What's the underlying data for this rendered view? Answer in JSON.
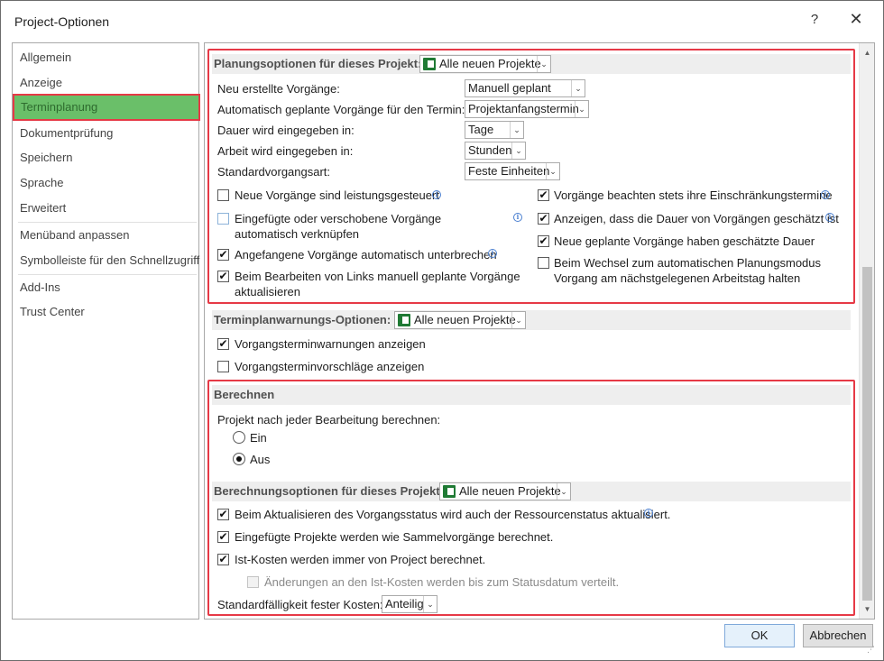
{
  "window": {
    "title": "Project-Optionen",
    "help_glyph": "?",
    "close_glyph": "✕"
  },
  "sidebar": {
    "items": [
      {
        "label": "Allgemein"
      },
      {
        "label": "Anzeige"
      },
      {
        "label": "Terminplanung"
      },
      {
        "label": "Dokumentprüfung"
      },
      {
        "label": "Speichern"
      },
      {
        "label": "Sprache"
      },
      {
        "label": "Erweitert"
      },
      {
        "label": "Menüband anpassen"
      },
      {
        "label": "Symbolleiste für den Schnellzugriff"
      },
      {
        "label": "Add-Ins"
      },
      {
        "label": "Trust Center"
      }
    ],
    "selected": "Terminplanung"
  },
  "planung": {
    "header": "Planungsoptionen für dieses Projekt:",
    "project_select": "Alle neuen Projekte",
    "rows": [
      {
        "label": "Neu erstellte Vorgänge:",
        "value": "Manuell geplant"
      },
      {
        "label": "Automatisch geplante Vorgänge für den Termin:",
        "value": "Projektanfangstermin"
      },
      {
        "label": "Dauer wird eingegeben in:",
        "value": "Tage"
      },
      {
        "label": "Arbeit wird eingegeben in:",
        "value": "Stunden"
      },
      {
        "label": "Standardvorgangsart:",
        "value": "Feste Einheiten"
      }
    ],
    "left_checks": [
      {
        "label": "Neue Vorgänge sind leistungsgesteuert",
        "checked": false
      },
      {
        "label": "Eingefügte oder verschobene Vorgänge automatisch verknüpfen",
        "checked": false
      },
      {
        "label": "Angefangene Vorgänge automatisch unterbrechen",
        "checked": true
      },
      {
        "label": "Beim Bearbeiten von Links manuell geplante Vorgänge aktualisieren",
        "checked": true
      }
    ],
    "right_checks": [
      {
        "label": "Vorgänge beachten stets ihre Einschränkungstermine",
        "checked": true
      },
      {
        "label": "Anzeigen, dass die Dauer von Vorgängen geschätzt ist",
        "checked": true
      },
      {
        "label": "Neue geplante Vorgänge haben geschätzte Dauer",
        "checked": true
      },
      {
        "label": "Beim Wechsel zum automatischen Planungsmodus Vorgang am nächstgelegenen Arbeitstag halten",
        "checked": false
      }
    ]
  },
  "warnungen": {
    "header": "Terminplanwarnungs-Optionen:",
    "project_select": "Alle neuen Projekte",
    "checks": [
      {
        "label": "Vorgangsterminwarnungen anzeigen",
        "checked": true
      },
      {
        "label": "Vorgangsterminvorschläge anzeigen",
        "checked": false
      }
    ]
  },
  "berechnen": {
    "header": "Berechnen",
    "question": "Projekt nach jeder Bearbeitung berechnen:",
    "radios": [
      {
        "label": "Ein",
        "selected": false
      },
      {
        "label": "Aus",
        "selected": true
      }
    ]
  },
  "berechnungsoptionen": {
    "header": "Berechnungsoptionen für dieses Projekt:",
    "project_select": "Alle neuen Projekte",
    "checks": [
      {
        "label": "Beim Aktualisieren des Vorgangsstatus wird auch der Ressourcenstatus aktualisiert.",
        "checked": true
      },
      {
        "label": "Eingefügte Projekte werden wie Sammelvorgänge berechnet.",
        "checked": true
      },
      {
        "label": "Ist-Kosten werden immer von Project berechnet.",
        "checked": true
      },
      {
        "label": "Änderungen an den Ist-Kosten werden bis zum Statusdatum verteilt.",
        "checked": false,
        "disabled": true
      }
    ],
    "fixed_cost_label": "Standardfälligkeit fester Kosten:",
    "fixed_cost_value": "Anteilig"
  },
  "footer": {
    "ok_label": "OK",
    "cancel_label": "Abbrechen"
  },
  "glyphs": {
    "check": "✔",
    "dropdown": "⌄",
    "scroll_up": "▲",
    "scroll_down": "▼",
    "info": "i"
  },
  "colors": {
    "highlight_red": "#e63946",
    "selected_green": "#6abf69"
  }
}
